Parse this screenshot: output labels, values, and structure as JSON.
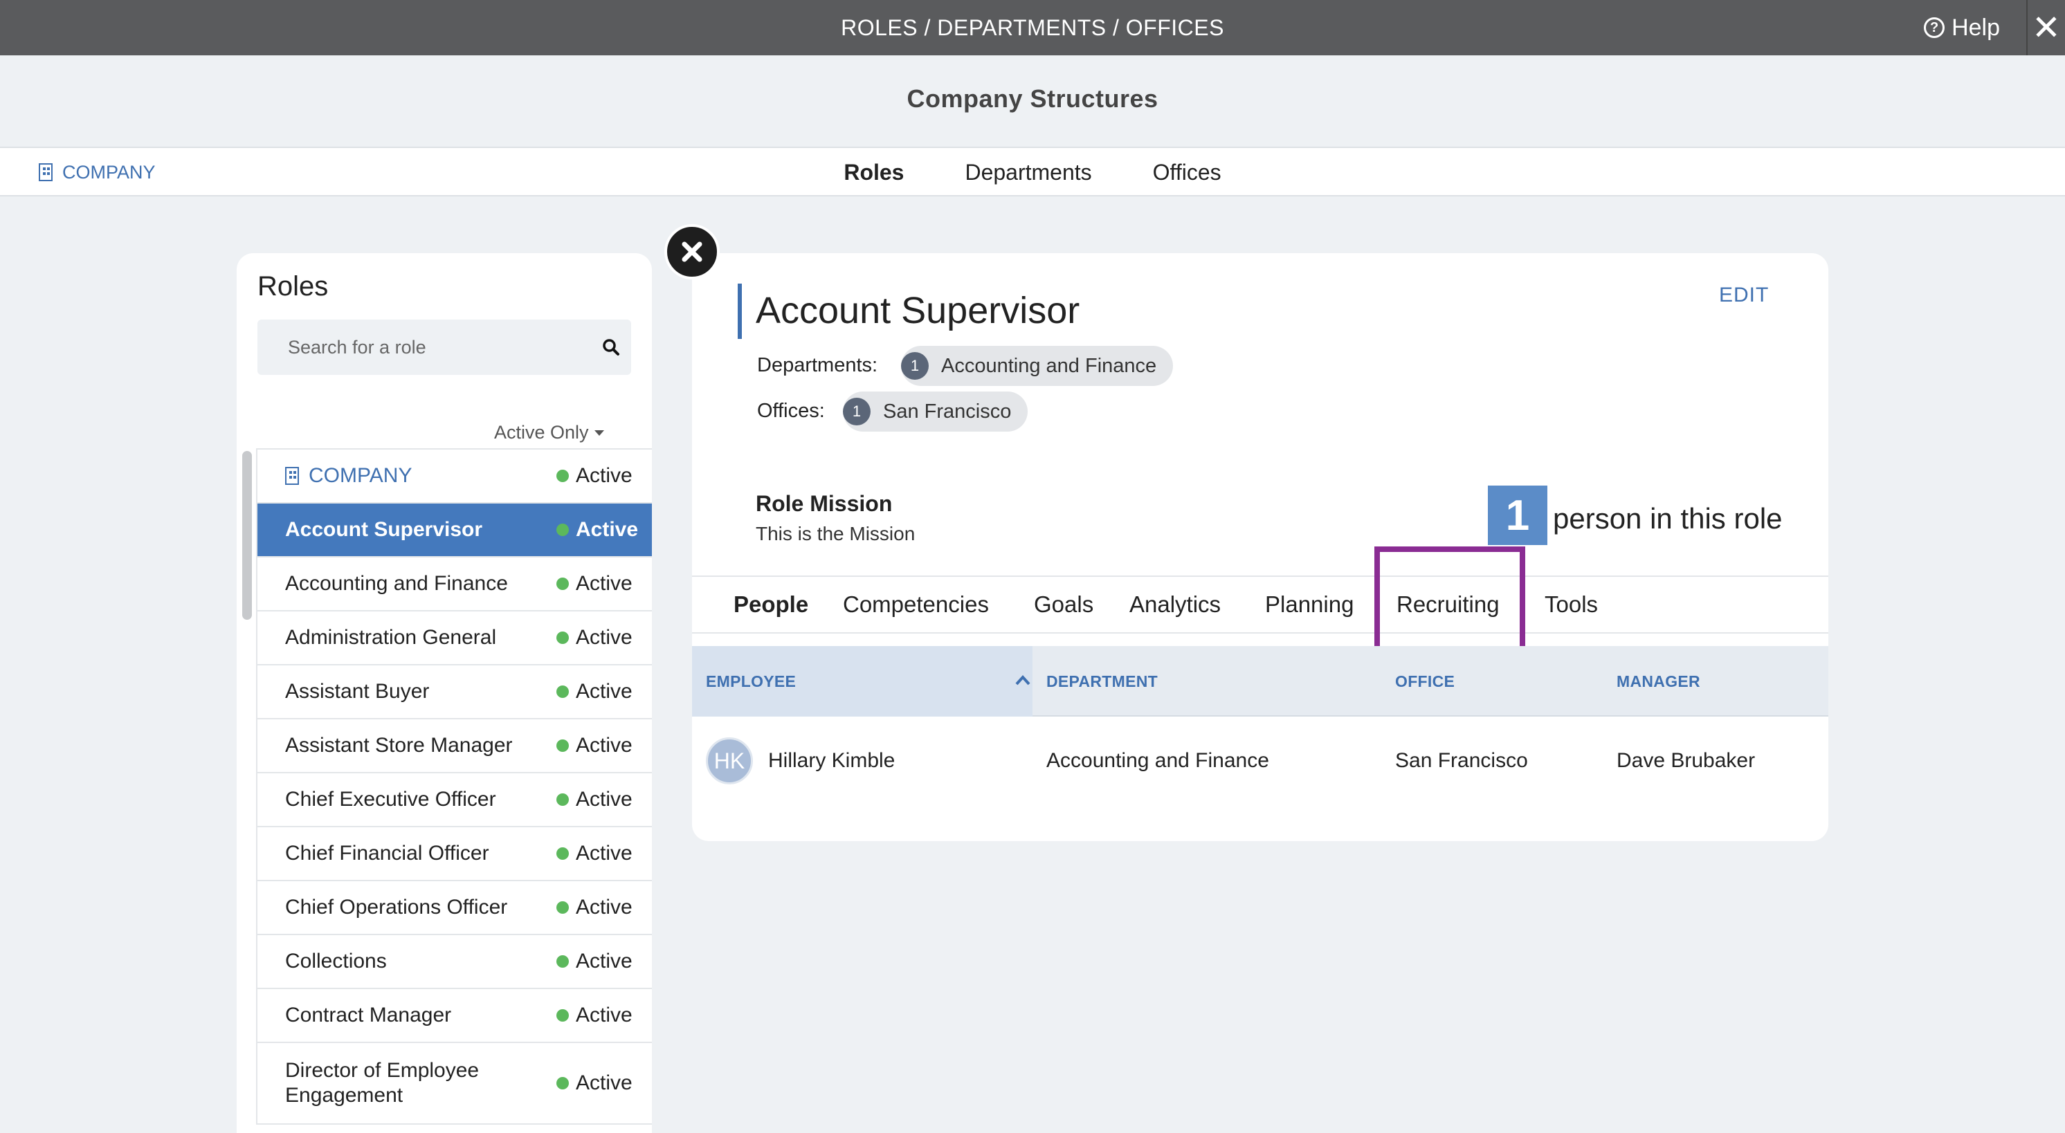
{
  "topbar": {
    "title": "ROLES / DEPARTMENTS / OFFICES",
    "help_label": "Help",
    "help_icon": "question-circle-icon",
    "close_icon": "close-icon"
  },
  "subheader": {
    "title": "Company Structures"
  },
  "navbar": {
    "company_label": "COMPANY",
    "tabs": [
      {
        "label": "Roles",
        "active": true
      },
      {
        "label": "Departments",
        "active": false
      },
      {
        "label": "Offices",
        "active": false
      }
    ]
  },
  "roles_panel": {
    "title": "Roles",
    "search_placeholder": "Search for a role",
    "filter_label": "Active Only",
    "items": [
      {
        "name": "COMPANY",
        "status": "Active"
      },
      {
        "name": "Account Supervisor",
        "status": "Active"
      },
      {
        "name": "Accounting and Finance",
        "status": "Active"
      },
      {
        "name": "Administration General",
        "status": "Active"
      },
      {
        "name": "Assistant Buyer",
        "status": "Active"
      },
      {
        "name": "Assistant Store Manager",
        "status": "Active"
      },
      {
        "name": "Chief Executive Officer",
        "status": "Active"
      },
      {
        "name": "Chief Financial Officer",
        "status": "Active"
      },
      {
        "name": "Chief Operations Officer",
        "status": "Active"
      },
      {
        "name": "Collections",
        "status": "Active"
      },
      {
        "name": "Contract Manager",
        "status": "Active"
      },
      {
        "name": "Director of Employee Engagement",
        "status": "Active"
      }
    ]
  },
  "detail": {
    "title": "Account Supervisor",
    "edit_label": "EDIT",
    "departments_label": "Departments:",
    "department": {
      "count": "1",
      "name": "Accounting and Finance"
    },
    "offices_label": "Offices:",
    "office": {
      "count": "1",
      "name": "San Francisco"
    },
    "mission_label": "Role Mission",
    "mission_text": "This is the Mission",
    "person_count": "1",
    "person_text": "person in this role",
    "tabs": [
      "People",
      "Competencies",
      "Goals",
      "Analytics",
      "Planning",
      "Recruiting",
      "Tools"
    ],
    "highlight_color": "#8a2c93",
    "table": {
      "columns": [
        "EMPLOYEE",
        "DEPARTMENT",
        "OFFICE",
        "MANAGER"
      ],
      "rows": [
        {
          "initials": "HK",
          "employee": "Hillary Kimble",
          "department": "Accounting and Finance",
          "office": "San Francisco",
          "manager": "Dave Brubaker"
        }
      ]
    }
  },
  "colors": {
    "accent": "#3f70b0",
    "selected_row": "#4479bd",
    "status_dot": "#5cb85c",
    "topbar": "#5a5b5d"
  }
}
